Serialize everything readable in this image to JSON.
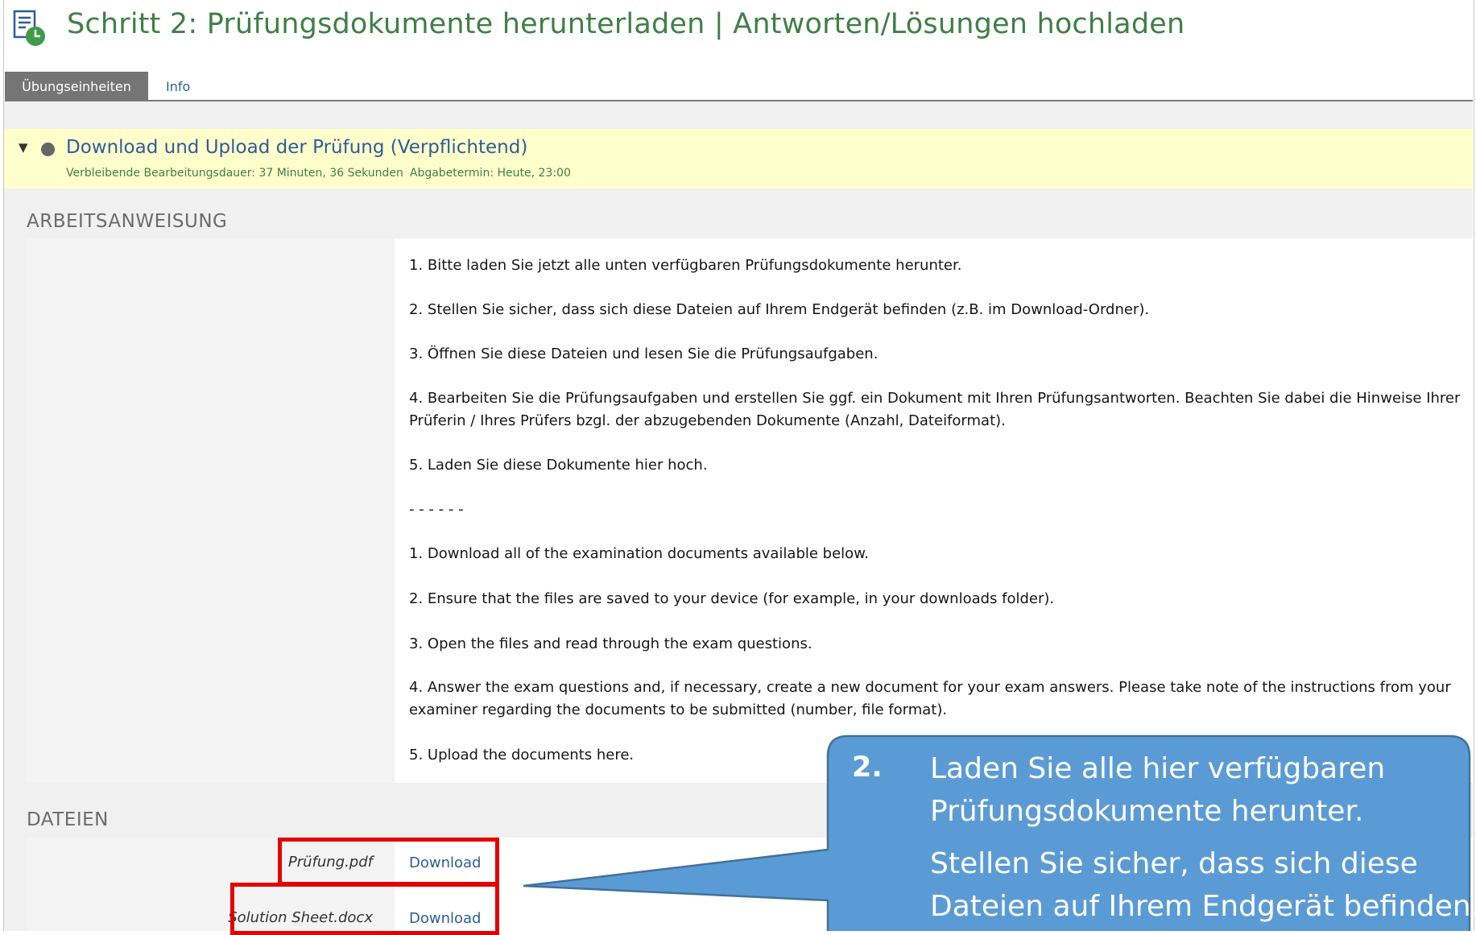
{
  "header": {
    "title": "Schritt 2: Prüfungsdokumente herunterladen | Antworten/Lösungen hochladen",
    "icon": "exercise-clock-icon"
  },
  "tabs": [
    {
      "label": "Übungseinheiten",
      "active": true
    },
    {
      "label": "Info",
      "active": false
    }
  ],
  "unit": {
    "title": "Download und Upload der Prüfung (Verpflichtend)",
    "remaining": "Verbleibende Bearbeitungsdauer: 37 Minuten, 36 Sekunden",
    "deadline": "Abgabetermin: Heute, 23:00"
  },
  "instructions": {
    "heading": "ARBEITSANWEISUNG",
    "lines": [
      "1. Bitte laden Sie jetzt alle unten verfügbaren Prüfungsdokumente herunter.",
      "2. Stellen Sie sicher, dass sich diese Dateien auf Ihrem Endgerät befinden (z.B. im Download-Ordner).",
      "3. Öffnen Sie diese Dateien und lesen Sie die Prüfungsaufgaben.",
      "4. Bearbeiten Sie die Prüfungsaufgaben und erstellen Sie ggf. ein Dokument mit Ihren Prüfungsantworten. Beachten Sie dabei die Hinweise Ihrer Prüferin / Ihres Prüfers bzgl. der abzugebenden Dokumente (Anzahl, Dateiformat).",
      "5. Laden Sie diese Dokumente hier hoch.",
      "- - - - - -",
      "1. Download all of the examination documents available below.",
      "2. Ensure that the files are saved to your device (for example, in your downloads folder).",
      "3. Open the files and read through the exam questions.",
      "4. Answer the exam questions and, if necessary, create a new document for your exam answers. Please take note of the instructions from your examiner regarding the documents to be submitted (number, file format).",
      "5. Upload the documents here."
    ]
  },
  "files": {
    "heading": "DATEIEN",
    "items": [
      {
        "name": "Prüfung.pdf",
        "action": "Download"
      },
      {
        "name": "Solution Sheet.docx",
        "action": "Download"
      }
    ]
  },
  "callout": {
    "number": "2.",
    "line1": "Laden Sie alle hier verfügbaren",
    "line2": "Prüfungsdokumente herunter.",
    "line3": "Stellen Sie sicher, dass sich diese",
    "line4": "Dateien auf Ihrem Endgerät befinden.",
    "fill_color": "#5b9bd5",
    "highlight_color": "#e30000"
  }
}
